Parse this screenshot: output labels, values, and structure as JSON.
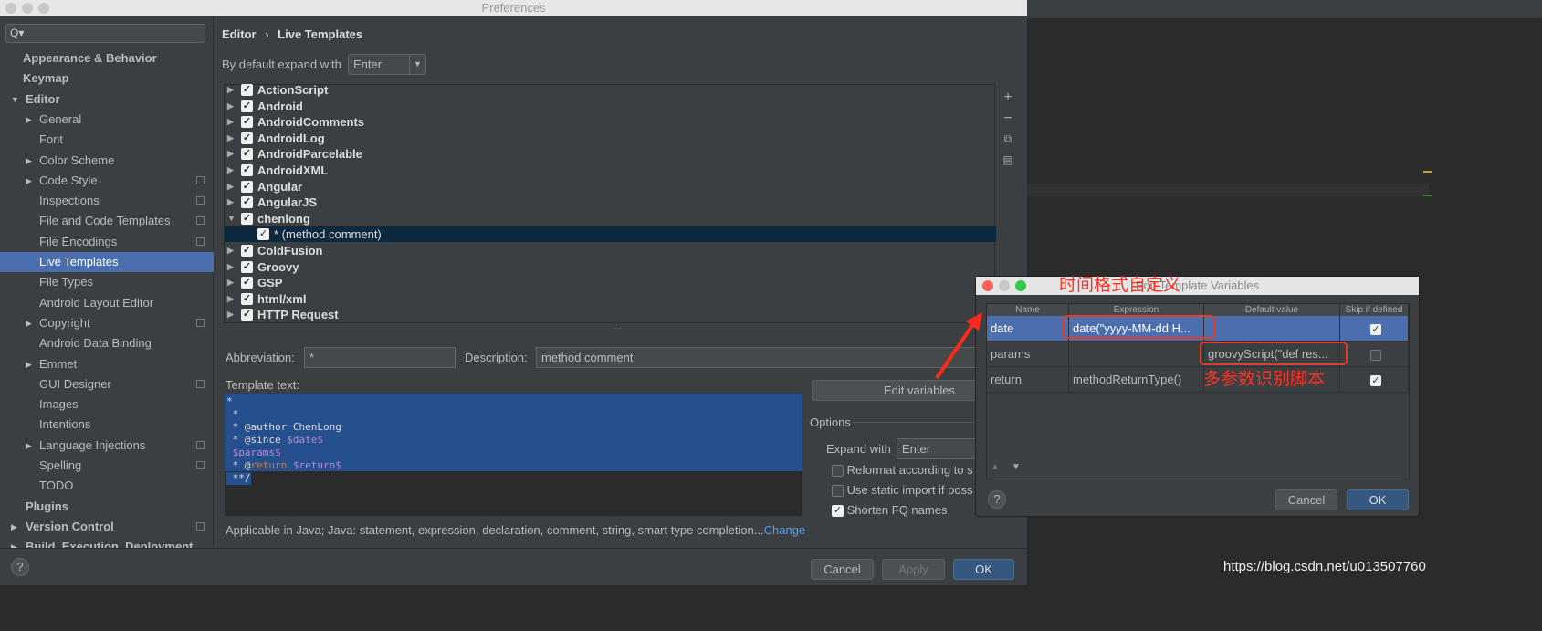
{
  "window": {
    "title": "Preferences"
  },
  "sidebar": {
    "search_placeholder": "Q▾",
    "items": [
      {
        "label": "Appearance & Behavior",
        "level": 0,
        "bold": true
      },
      {
        "label": "Keymap",
        "level": 0,
        "bold": true
      },
      {
        "label": "Editor",
        "level": 0,
        "bold": true,
        "expanded": true
      },
      {
        "label": "General",
        "level": 1,
        "arrow": true
      },
      {
        "label": "Font",
        "level": 1
      },
      {
        "label": "Color Scheme",
        "level": 1,
        "arrow": true
      },
      {
        "label": "Code Style",
        "level": 1,
        "arrow": true,
        "copy": true
      },
      {
        "label": "Inspections",
        "level": 1,
        "copy": true
      },
      {
        "label": "File and Code Templates",
        "level": 1,
        "copy": true
      },
      {
        "label": "File Encodings",
        "level": 1,
        "copy": true
      },
      {
        "label": "Live Templates",
        "level": 1,
        "selected": true
      },
      {
        "label": "File Types",
        "level": 1
      },
      {
        "label": "Android Layout Editor",
        "level": 1
      },
      {
        "label": "Copyright",
        "level": 1,
        "arrow": true,
        "copy": true
      },
      {
        "label": "Android Data Binding",
        "level": 1
      },
      {
        "label": "Emmet",
        "level": 1,
        "arrow": true
      },
      {
        "label": "GUI Designer",
        "level": 1,
        "copy": true
      },
      {
        "label": "Images",
        "level": 1
      },
      {
        "label": "Intentions",
        "level": 1
      },
      {
        "label": "Language Injections",
        "level": 1,
        "arrow": true,
        "copy": true
      },
      {
        "label": "Spelling",
        "level": 1,
        "copy": true
      },
      {
        "label": "TODO",
        "level": 1
      },
      {
        "label": "Plugins",
        "level": 0,
        "bold": true
      },
      {
        "label": "Version Control",
        "level": 0,
        "bold": true,
        "arrow": true,
        "copy": true
      },
      {
        "label": "Build, Execution, Deployment",
        "level": 0,
        "bold": true,
        "arrow": true
      }
    ]
  },
  "breadcrumb": {
    "parent": "Editor",
    "sep": "›",
    "current": "Live Templates"
  },
  "expand": {
    "label": "By default expand with",
    "value": "Enter"
  },
  "tree": [
    {
      "label": "ActionScript",
      "checked": true
    },
    {
      "label": "Android",
      "checked": true
    },
    {
      "label": "AndroidComments",
      "checked": true
    },
    {
      "label": "AndroidLog",
      "checked": true
    },
    {
      "label": "AndroidParcelable",
      "checked": true
    },
    {
      "label": "AndroidXML",
      "checked": true
    },
    {
      "label": "Angular",
      "checked": true
    },
    {
      "label": "AngularJS",
      "checked": true
    },
    {
      "label": "chenlong",
      "checked": true,
      "expanded": true
    },
    {
      "label": "* (method comment)",
      "checked": true,
      "child": true,
      "selected": true
    },
    {
      "label": "ColdFusion",
      "checked": true
    },
    {
      "label": "Groovy",
      "checked": true
    },
    {
      "label": "GSP",
      "checked": true
    },
    {
      "label": "html/xml",
      "checked": true
    },
    {
      "label": "HTTP Request",
      "checked": true
    }
  ],
  "toolbar_icons": [
    "plus-icon",
    "minus-icon",
    "copy-icon",
    "paste-icon"
  ],
  "form": {
    "abbr_label": "Abbreviation:",
    "abbr_value": "*",
    "desc_label": "Description:",
    "desc_value": "method comment",
    "template_label": "Template text:"
  },
  "template_lines": [
    [
      {
        "t": "*"
      }
    ],
    [
      {
        "t": " *"
      }
    ],
    [
      {
        "t": " * @author ChenLong"
      }
    ],
    [
      {
        "t": " * @since "
      },
      {
        "t": "$date$",
        "c": "var"
      }
    ],
    [
      {
        "t": " "
      },
      {
        "t": "$params$",
        "c": "var"
      }
    ],
    [
      {
        "t": " * @"
      },
      {
        "t": "return",
        "c": "kw"
      },
      {
        "t": " "
      },
      {
        "t": "$return$",
        "c": "var"
      }
    ],
    [
      {
        "t": " **/"
      }
    ]
  ],
  "options": {
    "edit_variables": "Edit variables",
    "title": "Options",
    "expand_label": "Expand with",
    "expand_value": "Enter",
    "checks": [
      {
        "label": "Reformat according to s",
        "checked": false
      },
      {
        "label": "Use static import if poss",
        "checked": false
      },
      {
        "label": "Shorten FQ names",
        "checked": true
      }
    ]
  },
  "applicable": {
    "text": "Applicable in Java; Java: statement, expression, declaration, comment, string, smart type completion...",
    "link": "Change"
  },
  "footer": {
    "cancel": "Cancel",
    "apply": "Apply",
    "ok": "OK",
    "help": "?"
  },
  "dialog": {
    "title": "Edit Template Variables",
    "columns": [
      "Name",
      "Expression",
      "Default value",
      "Skip if defined"
    ],
    "rows": [
      {
        "name": "date",
        "expression": "date(\"yyyy-MM-dd H...",
        "default": "",
        "skip": true,
        "selected": true
      },
      {
        "name": "params",
        "expression": "",
        "default": "groovyScript(\"def res...",
        "skip": false
      },
      {
        "name": "return",
        "expression": "methodReturnType()",
        "default": "",
        "skip": true
      }
    ],
    "cancel": "Cancel",
    "ok": "OK",
    "help": "?"
  },
  "annotations": {
    "top": "时间格式自定义",
    "bottom": "多参数识别脚本",
    "color": "#ff3324"
  },
  "watermark": "https://blog.csdn.net/u013507760"
}
